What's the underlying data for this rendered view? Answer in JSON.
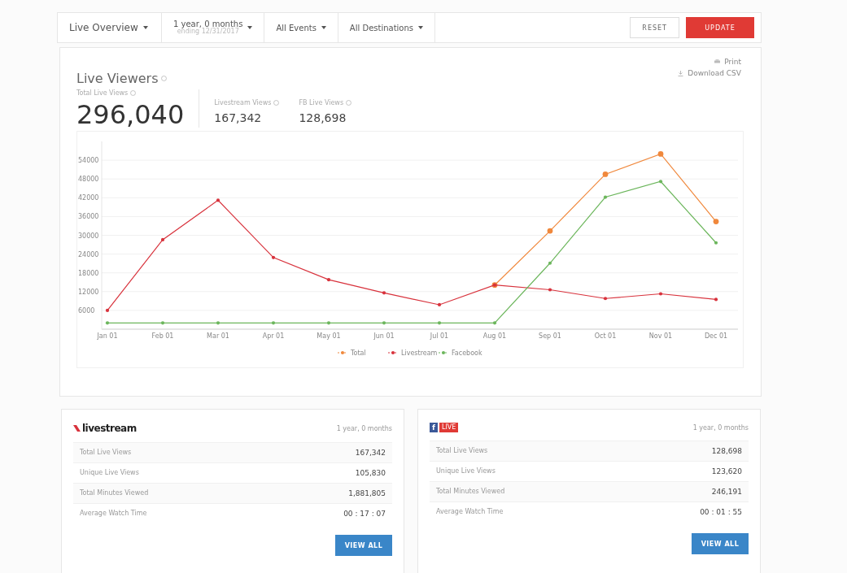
{
  "toolbar": {
    "view": "Live Overview",
    "range": {
      "label": "1 year, 0 months",
      "sub": "ending 12/31/2017"
    },
    "events": "All Events",
    "destinations": "All Destinations",
    "buttons": [
      "RESET",
      "UPDATE"
    ]
  },
  "live_viewers": {
    "title": "Live Viewers",
    "actions": [
      "Print",
      "Download CSV"
    ],
    "stats": [
      {
        "label": "Total Live Views",
        "value": "296,040",
        "kind": "main"
      },
      {
        "label": "Livestream Views",
        "value": "167,342",
        "kind": "sub"
      },
      {
        "label": "FB Live Views",
        "value": "128,698",
        "kind": "sub"
      }
    ],
    "chart_data": {
      "type": "line",
      "categories": [
        "Jan 01",
        "Feb 01",
        "Mar 01",
        "Apr 01",
        "May 01",
        "Jun 01",
        "Jul 01",
        "Aug 01",
        "Sep 01",
        "Oct 01",
        "Nov 01",
        "Dec 01"
      ],
      "ylim": [
        0,
        60000
      ],
      "grid": true,
      "legend": true,
      "yticks": [
        {
          "value": 6000,
          "label": "6000"
        },
        12000,
        18000,
        24000,
        30000,
        36000,
        42000,
        48000,
        54000
      ],
      "series": [
        {
          "name": "Total",
          "color": "#f0883c",
          "marker": true,
          "values": [
            null,
            null,
            null,
            null,
            null,
            null,
            null,
            14100,
            31400,
            49500,
            56000,
            34400
          ]
        },
        {
          "name": "Livestream",
          "color": "#d8323c",
          "marker": true,
          "values": [
            6000,
            28600,
            41200,
            22900,
            15800,
            11600,
            7800,
            14100,
            12600,
            9800,
            11300,
            9500
          ]
        },
        {
          "name": "Facebook",
          "color": "#6cb65c",
          "marker": true,
          "values": [
            2000,
            2000,
            2000,
            2000,
            2000,
            2000,
            2000,
            2000,
            21100,
            42200,
            47200,
            27600
          ]
        }
      ]
    }
  },
  "cards": [
    {
      "kind": "livestream",
      "brand": "livestream",
      "period": "1 year, 0 months",
      "rows": [
        {
          "label": "Total Live Views",
          "value": "167,342"
        },
        {
          "label": "Unique Live Views",
          "value": "105,830"
        },
        {
          "label": "Total Minutes Viewed",
          "value": "1,881,805"
        },
        {
          "label": "Average Watch Time",
          "value": "00 : 17 : 07"
        }
      ],
      "button": "VIEW ALL"
    },
    {
      "kind": "facebook",
      "brand": "f",
      "badge": "LIVE",
      "period": "1 year, 0 months",
      "rows": [
        {
          "label": "Total Live Views",
          "value": "128,698"
        },
        {
          "label": "Unique Live Views",
          "value": "123,620"
        },
        {
          "label": "Total Minutes Viewed",
          "value": "246,191"
        },
        {
          "label": "Average Watch Time",
          "value": "00 : 01 : 55"
        }
      ],
      "button": "VIEW ALL"
    }
  ]
}
